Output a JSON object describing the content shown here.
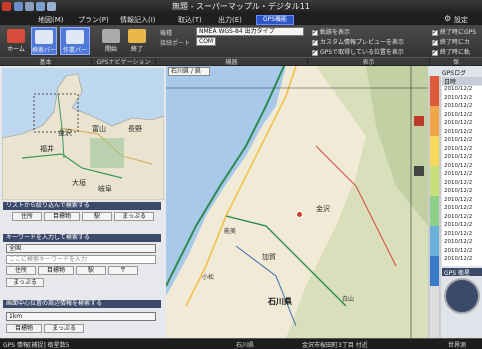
{
  "window": {
    "title": "無題 - スーパーマップル・デジタル11"
  },
  "menubar": {
    "items": [
      "地図(M)",
      "プラン(P)",
      "情報記入(I)",
      "取込(T)",
      "出力(E)"
    ],
    "gps_label": "GPS機能",
    "settings_label": "設定"
  },
  "ribbon": {
    "buttons": {
      "home": "ホーム",
      "search_bar": "検索バー",
      "work_bar": "作業バー",
      "open": "開始",
      "end": "終了"
    },
    "model_label": "機種",
    "model_value": "NMEA WGS-84 出力タイプ",
    "port_label": "接続ポート",
    "port_value": "COM",
    "checks": [
      {
        "label": "軌跡を表示",
        "checked": true
      },
      {
        "label": "カスタム情報プレビューを表示",
        "checked": true
      },
      {
        "label": "GPSで取得している位置を表示",
        "checked": true
      },
      {
        "label": "終了時にGPS",
        "checked": true
      },
      {
        "label": "終了時にカ",
        "checked": true
      },
      {
        "label": "終了時に軌",
        "checked": true
      }
    ],
    "groups": [
      "基本",
      "GPSナビゲーション",
      "機器",
      "表示",
      "保"
    ]
  },
  "leftpanel": {
    "minimap_labels": [
      "富山",
      "金沢",
      "福井",
      "長野",
      "大垣",
      "岐阜"
    ],
    "section1_head": "リストから絞り込んで検索する",
    "section1_buttons": [
      "住所",
      "目標物",
      "駅",
      "まっぷる"
    ],
    "section2_head": "キーワードを入力して検索する",
    "region_value": "全国",
    "keyword_placeholder": "ここに検索キーワードを入力",
    "section2_buttons": [
      "住所",
      "目標物",
      "駅",
      "〒"
    ],
    "section2_button_extra": "まっぷる",
    "section3_head": "画面中心位置の周辺情報を検索する",
    "distance_value": "1km",
    "section3_buttons": [
      "目標物",
      "まっぷる"
    ]
  },
  "map": {
    "tab_label": "石川県 / 県",
    "labels": [
      "石川県",
      "加賀",
      "金沢",
      "能美",
      "白山",
      "小松"
    ]
  },
  "rightpanel": {
    "title": "GPSログ",
    "column": "日時",
    "entries": [
      "2010/12/2",
      "2010/12/2",
      "2010/12/2",
      "2010/12/2",
      "2010/12/2",
      "2010/12/2",
      "2010/12/2",
      "2010/12/2",
      "2010/12/2",
      "2010/12/2",
      "2010/12/2",
      "2010/12/2",
      "2010/12/2",
      "2010/12/2",
      "2010/12/2",
      "2010/12/2",
      "2010/12/2",
      "2010/12/2",
      "2010/12/2",
      "2010/12/2",
      "2010/12/2"
    ],
    "footer_title": "GPS 衛星"
  },
  "statusbar": {
    "left": "GPS 情報[補捉] 衛星数5",
    "center_pref": "石川県",
    "center_addr": "金沢市桜田町3丁目 付近",
    "right": "世界測"
  }
}
